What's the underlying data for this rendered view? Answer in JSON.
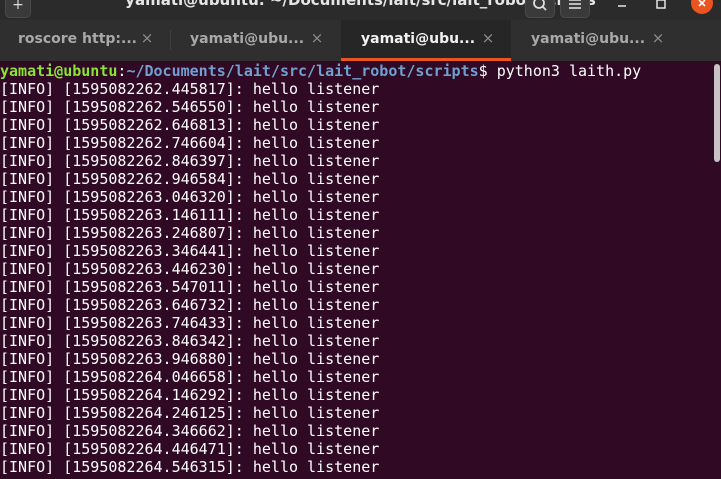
{
  "window": {
    "title": "yamati@ubuntu: ~/Documents/lait/src/lait_robot/scripts",
    "new_tab_glyph": "+",
    "icons": [
      "plus-icon",
      "search-icon",
      "hamburger-menu-icon",
      "minimize-icon",
      "maximize-icon",
      "close-icon"
    ]
  },
  "tabs": [
    {
      "label": "roscore http:...",
      "active": false,
      "close_glyph": "×"
    },
    {
      "label": "yamati@ubu...",
      "active": false,
      "close_glyph": "×"
    },
    {
      "label": "yamati@ubu...",
      "active": true,
      "close_glyph": "×"
    },
    {
      "label": "yamati@ubu...",
      "active": false,
      "close_glyph": "×"
    }
  ],
  "terminal": {
    "prompt": {
      "user_host": "yamati@ubuntu",
      "colon": ":",
      "path": "~/Documents/lait/src/lait_robot/scripts",
      "symbol": "$",
      "command": " python3 laith.py"
    },
    "lines": [
      "[INFO] [1595082262.445817]: hello listener",
      "[INFO] [1595082262.546550]: hello listener",
      "[INFO] [1595082262.646813]: hello listener",
      "[INFO] [1595082262.746604]: hello listener",
      "[INFO] [1595082262.846397]: hello listener",
      "[INFO] [1595082262.946584]: hello listener",
      "[INFO] [1595082263.046320]: hello listener",
      "[INFO] [1595082263.146111]: hello listener",
      "[INFO] [1595082263.246807]: hello listener",
      "[INFO] [1595082263.346441]: hello listener",
      "[INFO] [1595082263.446230]: hello listener",
      "[INFO] [1595082263.547011]: hello listener",
      "[INFO] [1595082263.646732]: hello listener",
      "[INFO] [1595082263.746433]: hello listener",
      "[INFO] [1595082263.846342]: hello listener",
      "[INFO] [1595082263.946880]: hello listener",
      "[INFO] [1595082264.046658]: hello listener",
      "[INFO] [1595082264.146292]: hello listener",
      "[INFO] [1595082264.246125]: hello listener",
      "[INFO] [1595082264.346662]: hello listener",
      "[INFO] [1595082264.446471]: hello listener",
      "[INFO] [1595082264.546315]: hello listener"
    ]
  },
  "colors": {
    "terminal_bg": "#300a24",
    "prompt_user": "#8ae234",
    "prompt_path": "#729fcf",
    "text": "#ffffff",
    "accent": "#e95420"
  }
}
